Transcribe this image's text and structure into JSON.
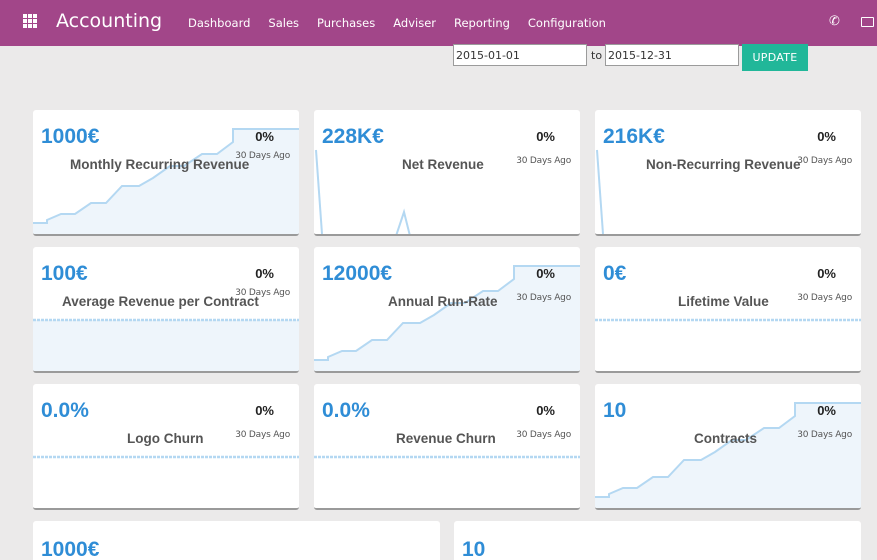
{
  "app": {
    "title": "Accounting"
  },
  "menu": [
    "Dashboard",
    "Sales",
    "Purchases",
    "Adviser",
    "Reporting",
    "Configuration"
  ],
  "filters": {
    "date_from": "2015-01-01",
    "to_label": "to",
    "date_to": "2015-12-31",
    "update_label": "UPDATE"
  },
  "cards": [
    {
      "value": "1000€",
      "change": "0%",
      "period": "30 Days Ago",
      "label": "Monthly Recurring Revenue"
    },
    {
      "value": "228K€",
      "change": "0%",
      "period": "30 Days Ago",
      "label": "Net Revenue"
    },
    {
      "value": "216K€",
      "change": "0%",
      "period": "30 Days Ago",
      "label": "Non-Recurring Revenue"
    },
    {
      "value": "100€",
      "change": "0%",
      "period": "30 Days Ago",
      "label": "Average Revenue per Contract"
    },
    {
      "value": "12000€",
      "change": "0%",
      "period": "30 Days Ago",
      "label": "Annual Run-Rate"
    },
    {
      "value": "0€",
      "change": "0%",
      "period": "30 Days Ago",
      "label": "Lifetime Value"
    },
    {
      "value": "0.0%",
      "change": "0%",
      "period": "30 Days Ago",
      "label": "Logo Churn"
    },
    {
      "value": "0.0%",
      "change": "0%",
      "period": "30 Days Ago",
      "label": "Revenue Churn"
    },
    {
      "value": "10",
      "change": "0%",
      "period": "30 Days Ago",
      "label": "Contracts"
    }
  ],
  "bottom_cards": [
    {
      "value": "1000€"
    },
    {
      "value": "10"
    }
  ],
  "colors": {
    "topbar": "#a24689",
    "accent": "#2f8dd6",
    "button": "#21b799",
    "spark_line": "#b4d8f2",
    "spark_fill": "#eef5fb"
  }
}
